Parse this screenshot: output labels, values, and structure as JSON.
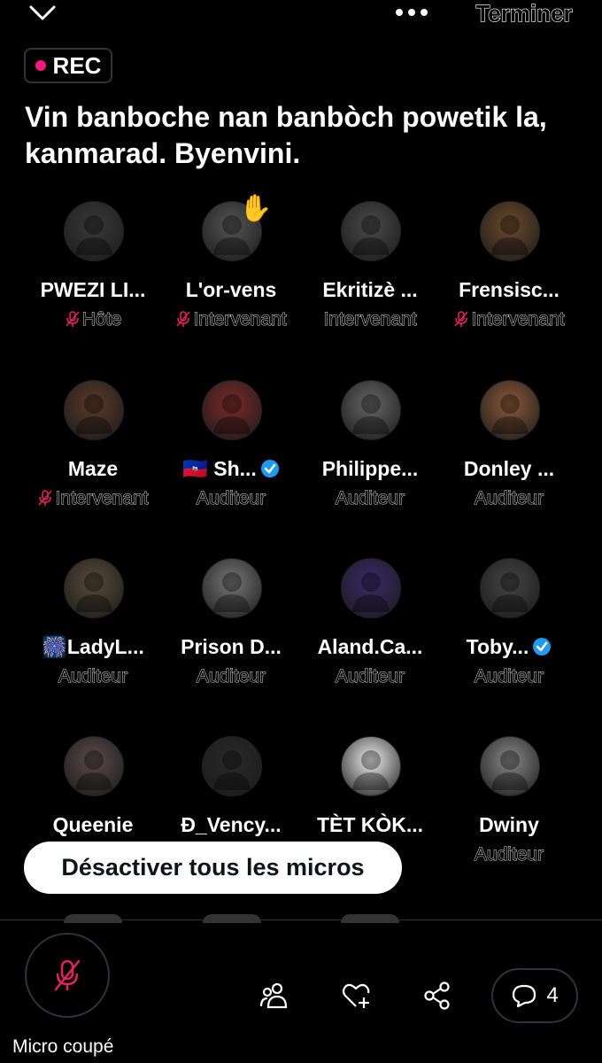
{
  "header": {
    "end_label": "Terminer"
  },
  "rec_label": "REC",
  "space_title": "Vin banboche nan banbòch powetik la, kanmarad. Byenvini.",
  "participants": [
    {
      "name": "PWEZI LI...",
      "role": "Hôte",
      "muted": true
    },
    {
      "name": "L'or-vens",
      "role": "Intervenant",
      "muted": true
    },
    {
      "name": "Ekritizè ...",
      "role": "Intervenant",
      "muted": false
    },
    {
      "name": "Frensisc...",
      "role": "Intervenant",
      "muted": true
    },
    {
      "name": "Maze",
      "role": "Intervenant",
      "muted": true
    },
    {
      "name": "🇭🇹 Sh...",
      "role": "Auditeur",
      "verified": true
    },
    {
      "name": "Philippe...",
      "role": "Auditeur"
    },
    {
      "name": "Donley ...",
      "role": "Auditeur"
    },
    {
      "name": "🎆LadyL...",
      "role": "Auditeur"
    },
    {
      "name": "Prison D...",
      "role": "Auditeur"
    },
    {
      "name": "Aland.Ca...",
      "role": "Auditeur"
    },
    {
      "name": "Toby...",
      "role": "Auditeur",
      "verified": true
    },
    {
      "name": "Queenie",
      "role": ""
    },
    {
      "name": "Đ_Vency...",
      "role": ""
    },
    {
      "name": "TÈT KÒK...",
      "role": "r"
    },
    {
      "name": "Dwiny",
      "role": "Auditeur"
    }
  ],
  "raised_hand": "✋",
  "mute_all_label": "Désactiver tous les micros",
  "footer": {
    "mic_status": "Micro coupé",
    "comments_count": "4"
  },
  "colors": {
    "accent": "#f91880",
    "verified": "#1d9bf0",
    "mic_muted": "#e0245e"
  },
  "icons": [
    "chevron-down-icon",
    "more-icon",
    "mic-off-icon",
    "people-icon",
    "heart-plus-icon",
    "share-icon",
    "comment-icon",
    "verified-icon"
  ]
}
